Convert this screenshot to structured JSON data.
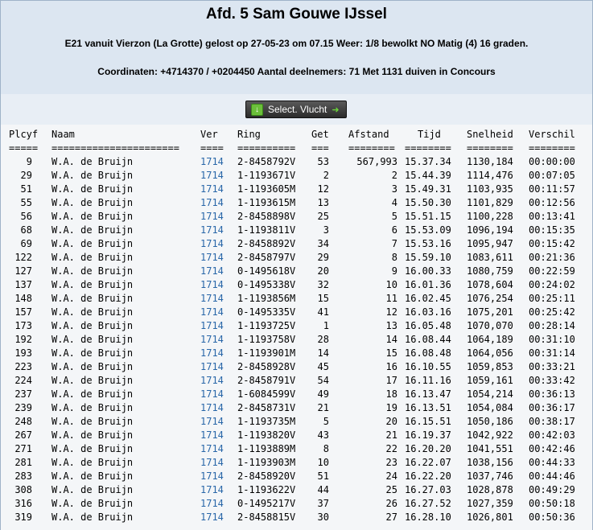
{
  "header": {
    "title": "Afd. 5 Sam Gouwe IJssel",
    "line1": "E21 vanuit Vierzon (La Grotte) gelost op 27-05-23 om 07.15 Weer: 1/8 bewolkt NO Matig (4) 16 graden.",
    "line2": "Coordinaten: +4714370 / +0204450 Aantal deelnemers: 71 Met 1131 duiven in Concours"
  },
  "toolbar": {
    "select_label": "Select. Vlucht",
    "icon": "download-icon"
  },
  "columns": {
    "plcyf": "Plcyf",
    "naam": "Naam",
    "ver": "Ver",
    "ring": "Ring",
    "get": "Get",
    "afstand": "Afstand",
    "tijd": "Tijd",
    "snelheid": "Snelheid",
    "verschil": "Verschil"
  },
  "separators": {
    "plcyf": "=====",
    "naam": "======================",
    "ver": "====",
    "ring": "==========",
    "get": "===",
    "afstand": "========",
    "tijd": "========",
    "snelheid": "========",
    "verschil": "========"
  },
  "rows": [
    {
      "plcyf": "9",
      "naam": "W.A. de Bruijn",
      "ver": "1714",
      "ring": "2-8458792V",
      "get": "53",
      "afstand": "567,993",
      "tijd": "15.37.34",
      "snelheid": "1130,184",
      "verschil": "00:00:00"
    },
    {
      "plcyf": "29",
      "naam": "W.A. de Bruijn",
      "ver": "1714",
      "ring": "1-1193671V",
      "get": "2",
      "afstand": "2",
      "tijd": "15.44.39",
      "snelheid": "1114,476",
      "verschil": "00:07:05"
    },
    {
      "plcyf": "51",
      "naam": "W.A. de Bruijn",
      "ver": "1714",
      "ring": "1-1193605M",
      "get": "12",
      "afstand": "3",
      "tijd": "15.49.31",
      "snelheid": "1103,935",
      "verschil": "00:11:57"
    },
    {
      "plcyf": "55",
      "naam": "W.A. de Bruijn",
      "ver": "1714",
      "ring": "1-1193615M",
      "get": "13",
      "afstand": "4",
      "tijd": "15.50.30",
      "snelheid": "1101,829",
      "verschil": "00:12:56"
    },
    {
      "plcyf": "56",
      "naam": "W.A. de Bruijn",
      "ver": "1714",
      "ring": "2-8458898V",
      "get": "25",
      "afstand": "5",
      "tijd": "15.51.15",
      "snelheid": "1100,228",
      "verschil": "00:13:41"
    },
    {
      "plcyf": "68",
      "naam": "W.A. de Bruijn",
      "ver": "1714",
      "ring": "1-1193811V",
      "get": "3",
      "afstand": "6",
      "tijd": "15.53.09",
      "snelheid": "1096,194",
      "verschil": "00:15:35"
    },
    {
      "plcyf": "69",
      "naam": "W.A. de Bruijn",
      "ver": "1714",
      "ring": "2-8458892V",
      "get": "34",
      "afstand": "7",
      "tijd": "15.53.16",
      "snelheid": "1095,947",
      "verschil": "00:15:42"
    },
    {
      "plcyf": "122",
      "naam": "W.A. de Bruijn",
      "ver": "1714",
      "ring": "2-8458797V",
      "get": "29",
      "afstand": "8",
      "tijd": "15.59.10",
      "snelheid": "1083,611",
      "verschil": "00:21:36"
    },
    {
      "plcyf": "127",
      "naam": "W.A. de Bruijn",
      "ver": "1714",
      "ring": "0-1495618V",
      "get": "20",
      "afstand": "9",
      "tijd": "16.00.33",
      "snelheid": "1080,759",
      "verschil": "00:22:59"
    },
    {
      "plcyf": "137",
      "naam": "W.A. de Bruijn",
      "ver": "1714",
      "ring": "0-1495338V",
      "get": "32",
      "afstand": "10",
      "tijd": "16.01.36",
      "snelheid": "1078,604",
      "verschil": "00:24:02"
    },
    {
      "plcyf": "148",
      "naam": "W.A. de Bruijn",
      "ver": "1714",
      "ring": "1-1193856M",
      "get": "15",
      "afstand": "11",
      "tijd": "16.02.45",
      "snelheid": "1076,254",
      "verschil": "00:25:11"
    },
    {
      "plcyf": "157",
      "naam": "W.A. de Bruijn",
      "ver": "1714",
      "ring": "0-1495335V",
      "get": "41",
      "afstand": "12",
      "tijd": "16.03.16",
      "snelheid": "1075,201",
      "verschil": "00:25:42"
    },
    {
      "plcyf": "173",
      "naam": "W.A. de Bruijn",
      "ver": "1714",
      "ring": "1-1193725V",
      "get": "1",
      "afstand": "13",
      "tijd": "16.05.48",
      "snelheid": "1070,070",
      "verschil": "00:28:14"
    },
    {
      "plcyf": "192",
      "naam": "W.A. de Bruijn",
      "ver": "1714",
      "ring": "1-1193758V",
      "get": "28",
      "afstand": "14",
      "tijd": "16.08.44",
      "snelheid": "1064,189",
      "verschil": "00:31:10"
    },
    {
      "plcyf": "193",
      "naam": "W.A. de Bruijn",
      "ver": "1714",
      "ring": "1-1193901M",
      "get": "14",
      "afstand": "15",
      "tijd": "16.08.48",
      "snelheid": "1064,056",
      "verschil": "00:31:14"
    },
    {
      "plcyf": "223",
      "naam": "W.A. de Bruijn",
      "ver": "1714",
      "ring": "2-8458928V",
      "get": "45",
      "afstand": "16",
      "tijd": "16.10.55",
      "snelheid": "1059,853",
      "verschil": "00:33:21"
    },
    {
      "plcyf": "224",
      "naam": "W.A. de Bruijn",
      "ver": "1714",
      "ring": "2-8458791V",
      "get": "54",
      "afstand": "17",
      "tijd": "16.11.16",
      "snelheid": "1059,161",
      "verschil": "00:33:42"
    },
    {
      "plcyf": "237",
      "naam": "W.A. de Bruijn",
      "ver": "1714",
      "ring": "1-6084599V",
      "get": "49",
      "afstand": "18",
      "tijd": "16.13.47",
      "snelheid": "1054,214",
      "verschil": "00:36:13"
    },
    {
      "plcyf": "239",
      "naam": "W.A. de Bruijn",
      "ver": "1714",
      "ring": "2-8458731V",
      "get": "21",
      "afstand": "19",
      "tijd": "16.13.51",
      "snelheid": "1054,084",
      "verschil": "00:36:17"
    },
    {
      "plcyf": "248",
      "naam": "W.A. de Bruijn",
      "ver": "1714",
      "ring": "1-1193735M",
      "get": "5",
      "afstand": "20",
      "tijd": "16.15.51",
      "snelheid": "1050,186",
      "verschil": "00:38:17"
    },
    {
      "plcyf": "267",
      "naam": "W.A. de Bruijn",
      "ver": "1714",
      "ring": "1-1193820V",
      "get": "43",
      "afstand": "21",
      "tijd": "16.19.37",
      "snelheid": "1042,922",
      "verschil": "00:42:03"
    },
    {
      "plcyf": "271",
      "naam": "W.A. de Bruijn",
      "ver": "1714",
      "ring": "1-1193889M",
      "get": "8",
      "afstand": "22",
      "tijd": "16.20.20",
      "snelheid": "1041,551",
      "verschil": "00:42:46"
    },
    {
      "plcyf": "281",
      "naam": "W.A. de Bruijn",
      "ver": "1714",
      "ring": "1-1193903M",
      "get": "10",
      "afstand": "23",
      "tijd": "16.22.07",
      "snelheid": "1038,156",
      "verschil": "00:44:33"
    },
    {
      "plcyf": "283",
      "naam": "W.A. de Bruijn",
      "ver": "1714",
      "ring": "2-8458920V",
      "get": "51",
      "afstand": "24",
      "tijd": "16.22.20",
      "snelheid": "1037,746",
      "verschil": "00:44:46"
    },
    {
      "plcyf": "308",
      "naam": "W.A. de Bruijn",
      "ver": "1714",
      "ring": "1-1193622V",
      "get": "44",
      "afstand": "25",
      "tijd": "16.27.03",
      "snelheid": "1028,878",
      "verschil": "00:49:29"
    },
    {
      "plcyf": "316",
      "naam": "W.A. de Bruijn",
      "ver": "1714",
      "ring": "0-1495217V",
      "get": "37",
      "afstand": "26",
      "tijd": "16.27.52",
      "snelheid": "1027,359",
      "verschil": "00:50:18"
    },
    {
      "plcyf": "319",
      "naam": "W.A. de Bruijn",
      "ver": "1714",
      "ring": "2-8458815V",
      "get": "30",
      "afstand": "27",
      "tijd": "16.28.10",
      "snelheid": "1026,801",
      "verschil": "00:50:36"
    }
  ]
}
